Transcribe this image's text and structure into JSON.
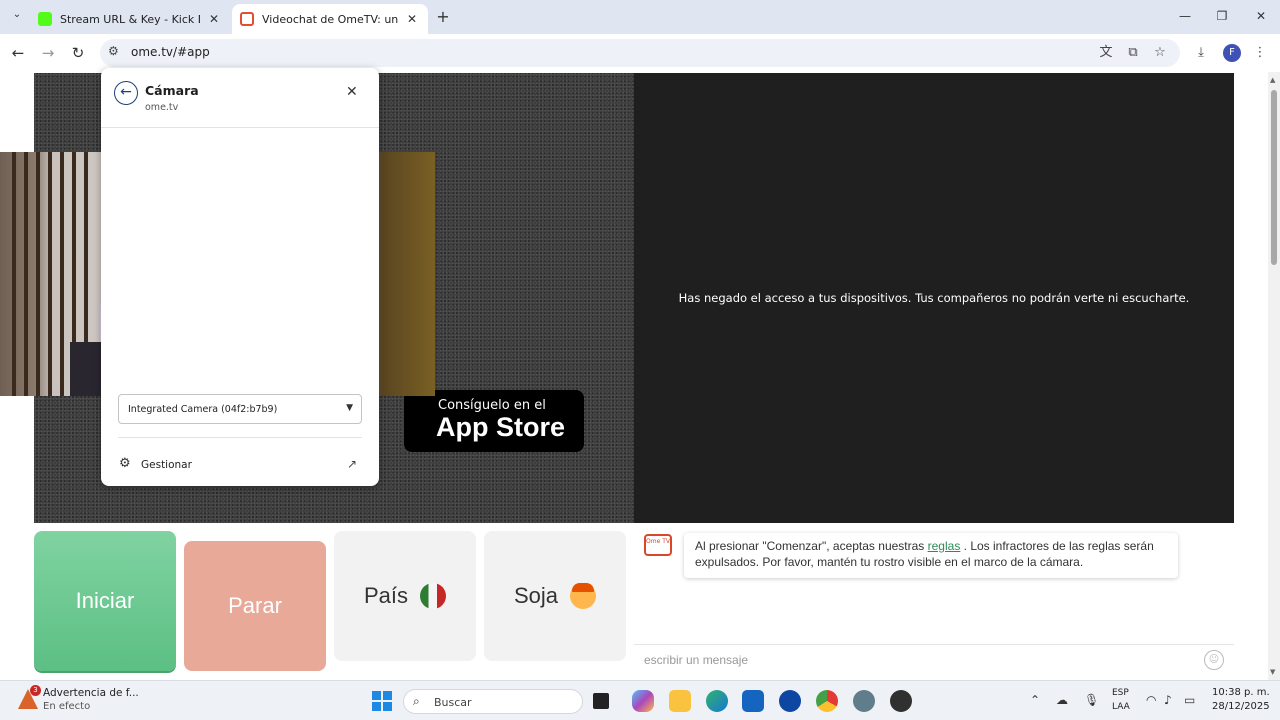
{
  "browser": {
    "tabs": [
      {
        "title": "Stream URL & Key - Kick Dashb",
        "favicon_color": "#53fc18",
        "active": false
      },
      {
        "title": "Videochat de OmeTV: una alter",
        "favicon_color": "#e0502f",
        "active": true
      }
    ],
    "url": "ome.tv/#app",
    "profile_initial": "F"
  },
  "camera_popup": {
    "title": "Cámara",
    "origin": "ome.tv",
    "selected_camera": "Integrated Camera (04f2:b7b9)",
    "manage_label": "Gestionar"
  },
  "video": {
    "denied_message": "Has negado el acceso a tus dispositivos. Tus compañeros no podrán verte ni escucharte."
  },
  "app_store": {
    "top_line": "Consíguelo en el",
    "main_line": "App Store"
  },
  "controls": {
    "start": "Iniciar",
    "stop": "Parar",
    "country": "País",
    "gender": "Soja"
  },
  "chat": {
    "logo_text": "Ome TV",
    "notice_before": "Al presionar \"Comenzar\", aceptas nuestras ",
    "notice_link": "reglas",
    "notice_after": " . Los infractores de las reglas serán expulsados. Por favor, mantén tu rostro visible en el marco de la cámara.",
    "input_placeholder": "escribir un mensaje"
  },
  "taskbar": {
    "weather_badge": "3",
    "weather_title": "Advertencia de f...",
    "weather_subtitle": "En efecto",
    "search_placeholder": "Buscar",
    "lang_line1": "ESP",
    "lang_line2": "LAA",
    "time": "10:38 p. m.",
    "date": "28/12/2025"
  },
  "colors": {
    "start_button": "#5cbf83",
    "stop_button": "#e8a999",
    "chat_link": "#2e8b57",
    "accent_blue": "#1e88e5"
  }
}
